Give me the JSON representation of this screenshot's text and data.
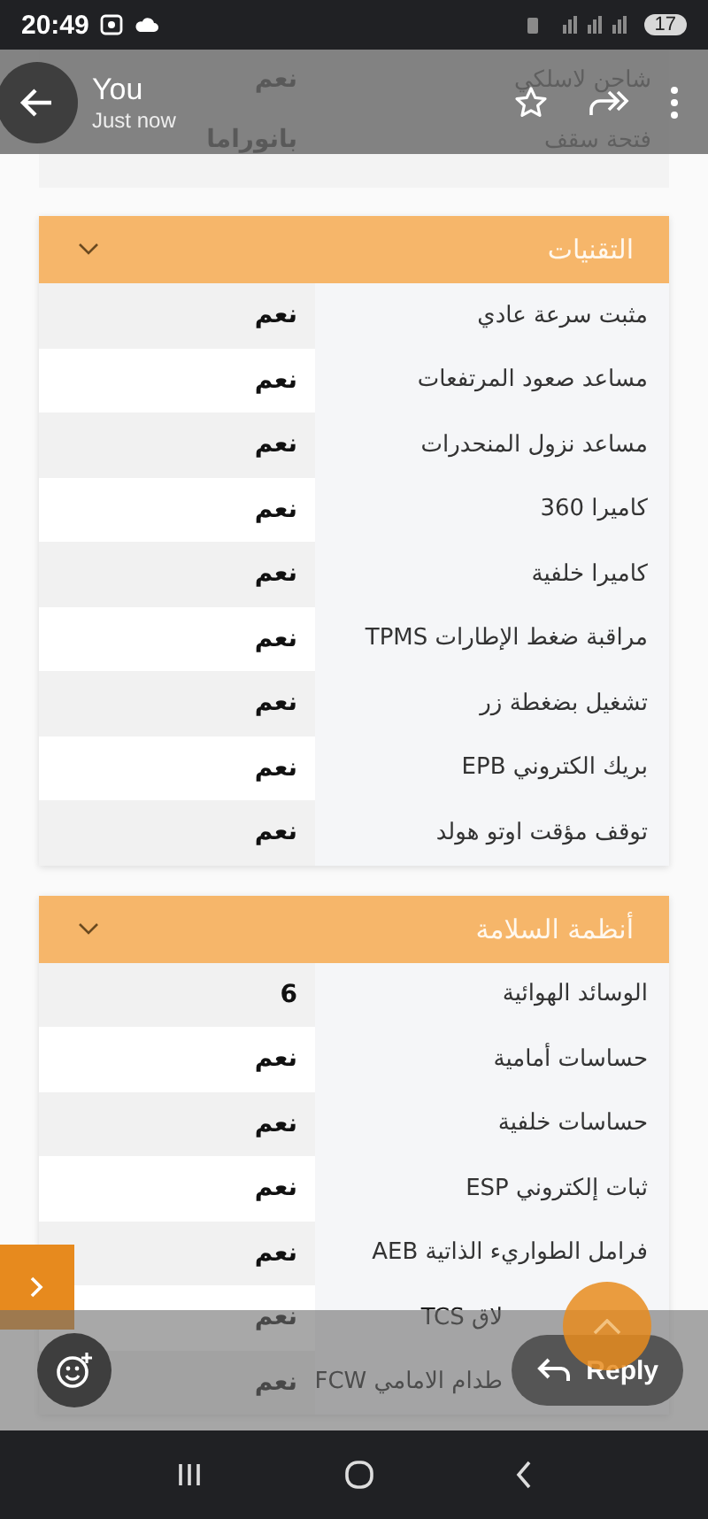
{
  "status_bar": {
    "time": "20:49",
    "battery": "17"
  },
  "message_header": {
    "sender": "You",
    "time": "Just now"
  },
  "previous_rows": [
    {
      "label": "شاحن لاسلكي",
      "value": "نعم"
    },
    {
      "label": "فتحة سقف",
      "value": "بانوراما"
    }
  ],
  "sections": [
    {
      "title": "التقنيات",
      "rows": [
        {
          "label": "مثبت سرعة عادي",
          "value": "نعم"
        },
        {
          "label": "مساعد صعود المرتفعات",
          "value": "نعم"
        },
        {
          "label": "مساعد نزول المنحدرات",
          "value": "نعم"
        },
        {
          "label": "كاميرا 360",
          "value": "نعم"
        },
        {
          "label": "كاميرا خلفية",
          "value": "نعم"
        },
        {
          "label": "مراقبة ضغط الإطارات TPMS",
          "value": "نعم"
        },
        {
          "label": "تشغيل بضغطة زر",
          "value": "نعم"
        },
        {
          "label": "بريك الكتروني EPB",
          "value": "نعم"
        },
        {
          "label": "توقف مؤقت اوتو هولد",
          "value": "نعم"
        }
      ]
    },
    {
      "title": "أنظمة السلامة",
      "rows": [
        {
          "label": "الوسائد الهوائية",
          "value": "6"
        },
        {
          "label": "حساسات أمامية",
          "value": "نعم"
        },
        {
          "label": "حساسات خلفية",
          "value": "نعم"
        },
        {
          "label": "ثبات إلكتروني ESP",
          "value": "نعم"
        },
        {
          "label": "فرامل الطواريء الذاتية AEB",
          "value": "نعم"
        },
        {
          "label": "لاق TCS",
          "value": "نعم",
          "kind": "overlapped"
        },
        {
          "label": "طدام الامامي FCW",
          "value": "نعم",
          "kind": "overlapped"
        }
      ]
    }
  ],
  "reply_button": {
    "label": "Reply"
  }
}
